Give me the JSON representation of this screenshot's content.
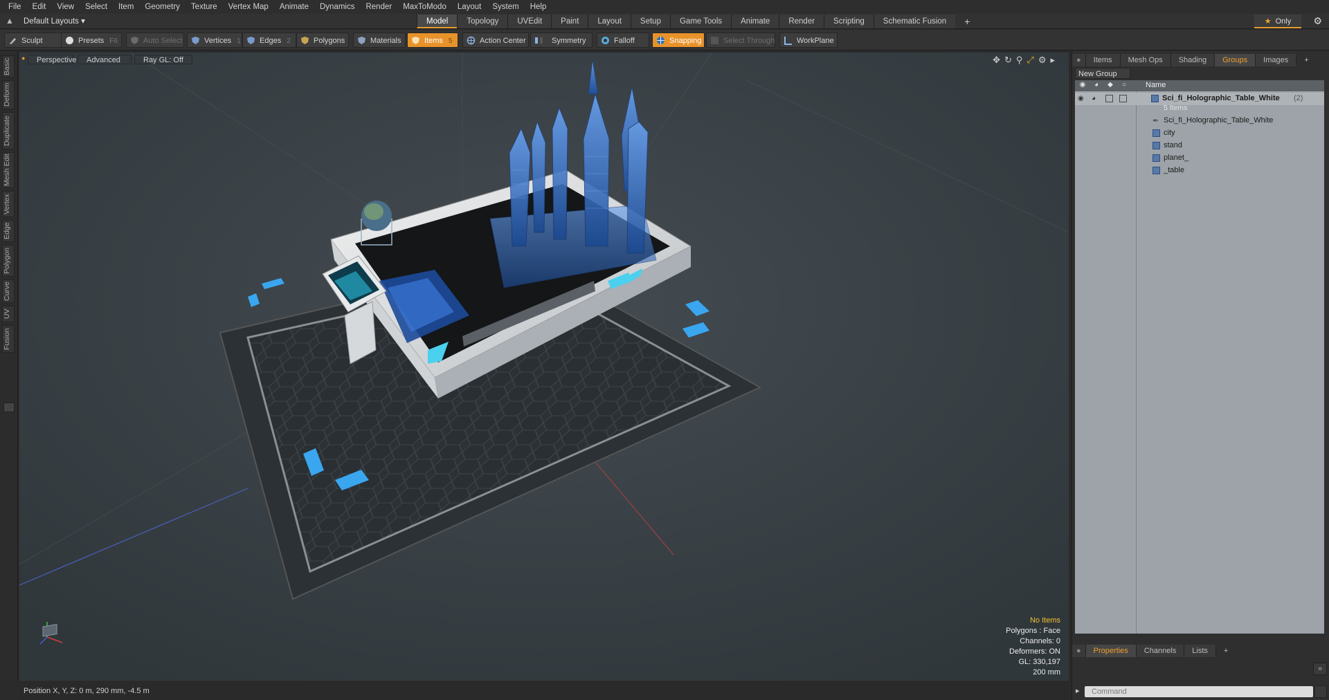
{
  "menu": [
    "File",
    "Edit",
    "View",
    "Select",
    "Item",
    "Geometry",
    "Texture",
    "Vertex Map",
    "Animate",
    "Dynamics",
    "Render",
    "MaxToModo",
    "Layout",
    "System",
    "Help"
  ],
  "layout_select": "Default Layouts ▾",
  "tabs": [
    "Model",
    "Topology",
    "UVEdit",
    "Paint",
    "Layout",
    "Setup",
    "Game Tools",
    "Animate",
    "Render",
    "Scripting",
    "Schematic Fusion"
  ],
  "only_label": "Only",
  "toolbar": {
    "sculpt": "Sculpt",
    "presets": "Presets",
    "presets_key": "F6",
    "auto_select": "Auto Select",
    "vertices": "Vertices",
    "vertices_key": "1",
    "edges": "Edges",
    "edges_key": "2",
    "polygons": "Polygons",
    "materials": "Materials",
    "items": "Items",
    "items_key": "5",
    "action_center": "Action Center",
    "symmetry": "Symmetry",
    "falloff": "Falloff",
    "snapping": "Snapping",
    "select_through": "Select Through",
    "workplane": "WorkPlane"
  },
  "left_tabs": [
    "Basic",
    "Deform",
    "Duplicate",
    "Mesh Edit",
    "Vertex",
    "Edge",
    "Polygon",
    "Curve",
    "UV",
    "Fusion"
  ],
  "viewport": {
    "perspective": "Perspective",
    "advanced": "Advanced",
    "raygl": "Ray GL: Off",
    "info_no_items": "No Items",
    "info_polygons": "Polygons : Face",
    "info_channels": "Channels: 0",
    "info_deformers": "Deformers: ON",
    "info_gl": "GL: 330,197",
    "info_scale": "200 mm"
  },
  "right_panel": {
    "tabs": [
      "Items",
      "Mesh Ops",
      "Shading",
      "Groups",
      "Images"
    ],
    "new_group": "New Group",
    "name_header": "Name",
    "group_name": "Sci_fi_Holographic_Table_White",
    "group_count": "(2)",
    "group_items": "5 Items",
    "children": [
      "Sci_fi_Holographic_Table_White",
      "city",
      "stand",
      "planet_",
      "_table"
    ],
    "bottom_tabs": [
      "Properties",
      "Channels",
      "Lists"
    ],
    "command_placeholder": "Command"
  },
  "status": "Position X, Y, Z:  0 m, 290 mm, -4.5 m",
  "colors": {
    "accent": "#e8922a",
    "tree_bg": "#9da3a8",
    "holo_blue": "#3a78d8"
  }
}
